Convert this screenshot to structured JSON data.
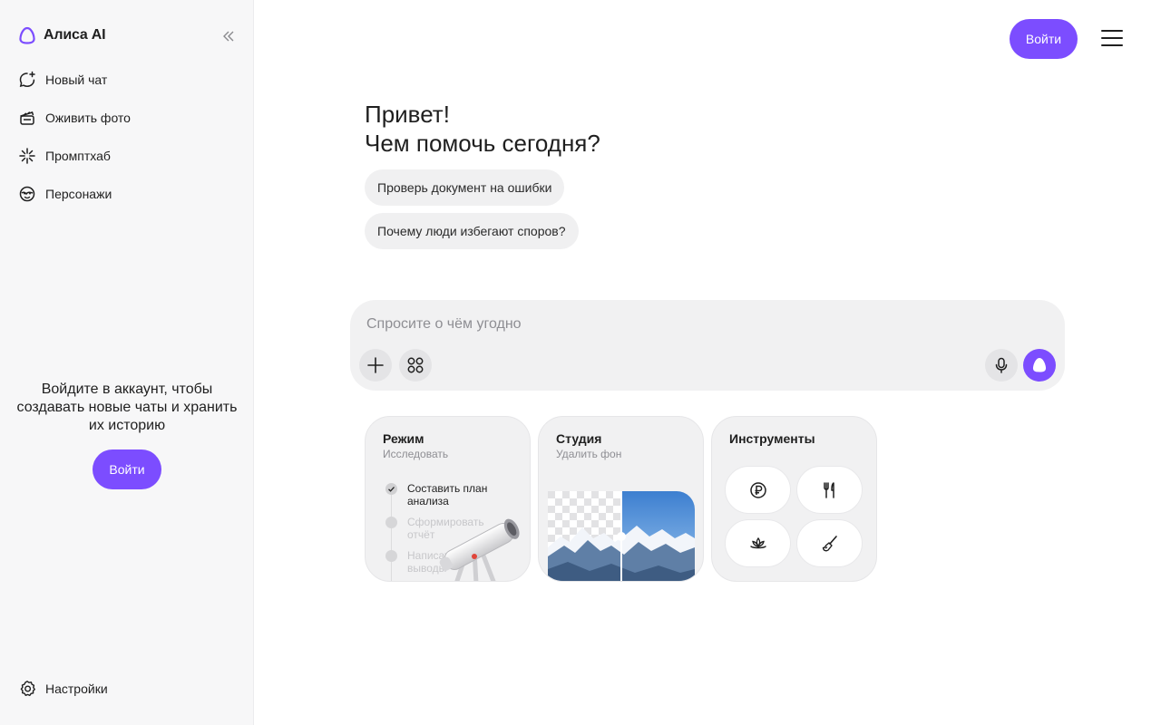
{
  "app": {
    "title": "Алиса AI",
    "accent": "#7c4dff"
  },
  "sidebar": {
    "items": [
      {
        "label": "Новый чат",
        "icon": "new-chat-icon"
      },
      {
        "label": "Оживить фото",
        "icon": "clapperboard-icon"
      },
      {
        "label": "Промптхаб",
        "icon": "sparkle-icon"
      },
      {
        "label": "Персонажи",
        "icon": "mask-icon"
      }
    ],
    "login_prompt": "Войдите в аккаунт, чтобы создавать новые чаты и хранить их историю",
    "login_button": "Войти",
    "settings_label": "Настройки"
  },
  "header": {
    "login_button": "Войти"
  },
  "greeting": {
    "line1": "Привет!",
    "line2": "Чем помочь сегодня?"
  },
  "suggestions": [
    "Проверь документ на ошибки",
    "Почему люди избегают споров?"
  ],
  "composer": {
    "placeholder": "Спросите о чём угодно"
  },
  "cards": {
    "mode": {
      "title": "Режим",
      "subtitle": "Исследовать",
      "steps": [
        "Составить план анализа",
        "Сформировать отчёт",
        "Написать выводы"
      ]
    },
    "studio": {
      "title": "Студия",
      "subtitle": "Удалить фон"
    },
    "tools": {
      "title": "Инструменты",
      "icons": [
        "ruble-coin-icon",
        "fork-knife-icon",
        "lotus-icon",
        "paint-brush-icon"
      ]
    }
  }
}
